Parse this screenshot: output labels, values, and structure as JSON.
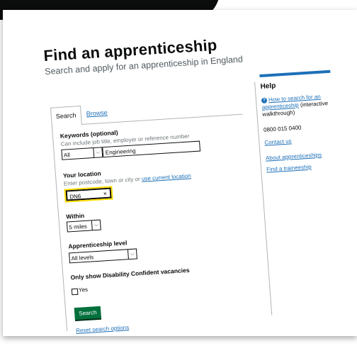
{
  "page": {
    "title": "Find an apprenticeship",
    "subtitle": "Search and apply for an apprenticeship in England"
  },
  "tabs": [
    {
      "label": "Search",
      "active": true
    },
    {
      "label": "Browse",
      "active": false
    }
  ],
  "keywords": {
    "label": "Keywords (optional)",
    "hint": "Can include job title, employer or reference number",
    "category_selected": "All",
    "value": "Engineering"
  },
  "location": {
    "label": "Your location",
    "hint": "Enter postcode, town or city or",
    "hint_link": "use current location",
    "value": "DN6",
    "clear_glyph": "×"
  },
  "within": {
    "label": "Within",
    "selected": "5 miles"
  },
  "level": {
    "label": "Apprenticeship level",
    "selected": "All levels"
  },
  "disability": {
    "label": "Only show Disability Confident vacancies",
    "option_label": "Yes"
  },
  "actions": {
    "search_label": "Search",
    "reset_label": "Reset search options"
  },
  "help": {
    "heading": "Help",
    "how_to_link": "How to search for an apprenticeship",
    "how_to_suffix": "(interactive walkthrough)",
    "phone": "0800 015 0400",
    "contact": "Contact us",
    "about": "About apprenticeships",
    "traineeship": "Find a traineeship"
  },
  "colors": {
    "link": "#1d70b8",
    "button": "#00703c",
    "focus": "#ffdd00",
    "help_bar": "#1d70b8"
  }
}
